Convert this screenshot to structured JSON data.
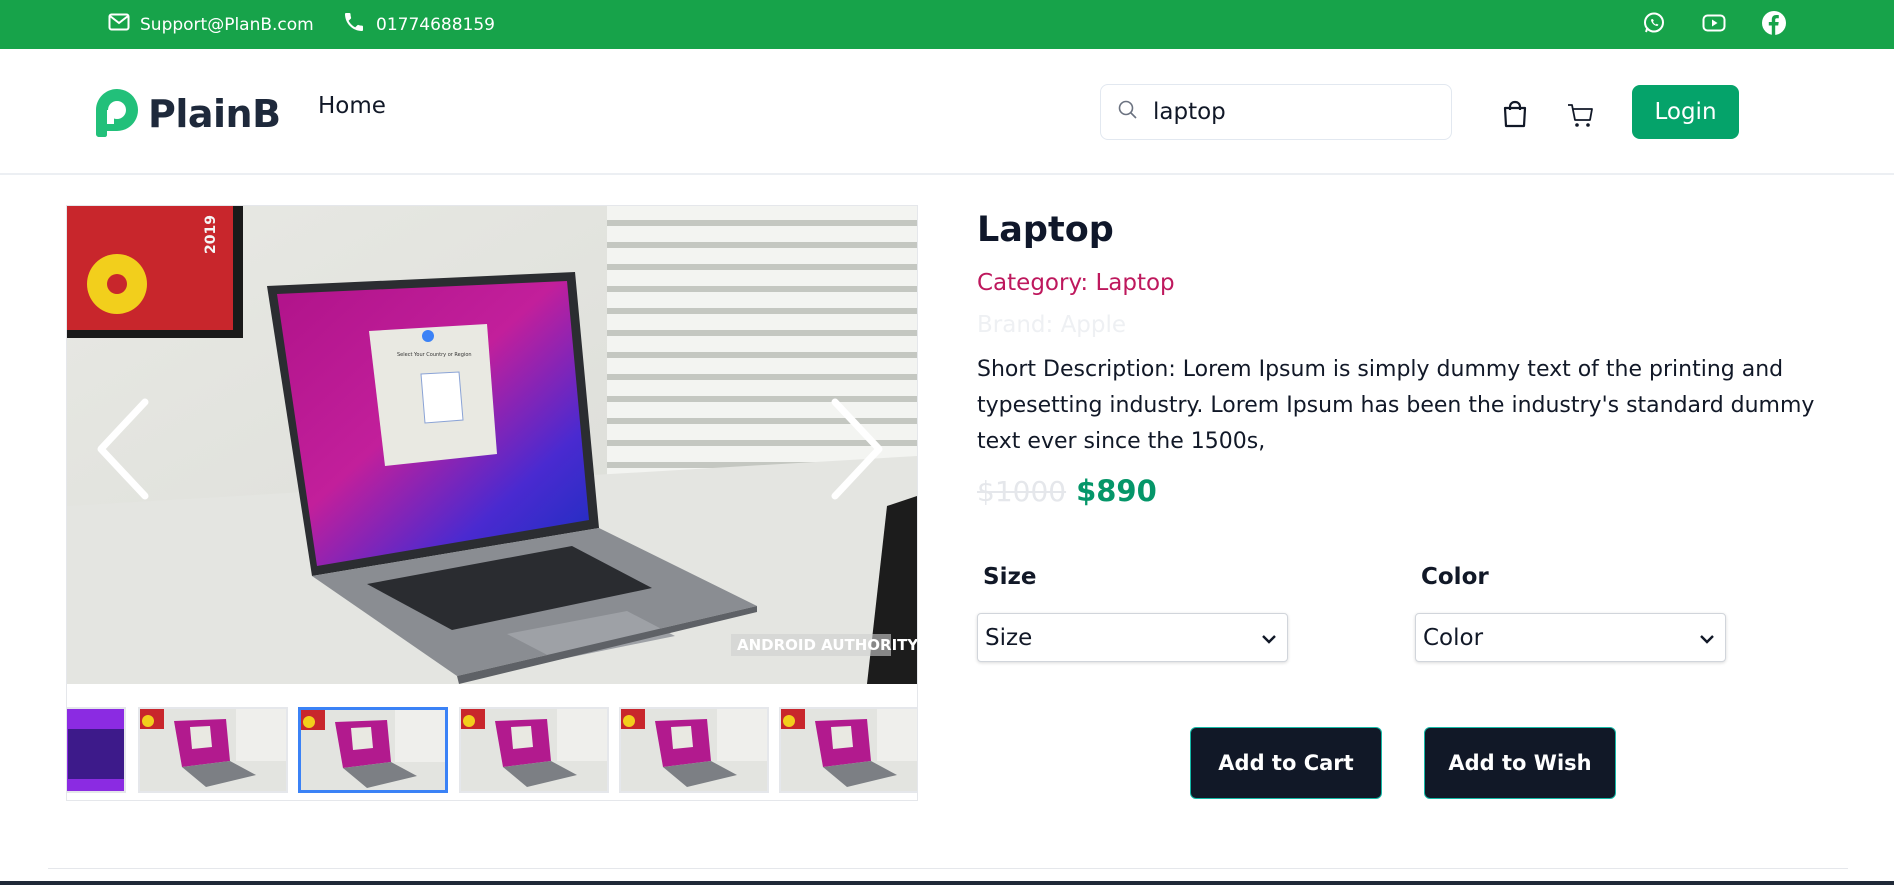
{
  "topbar": {
    "email": "Support@PlanB.com",
    "phone": "01774688159",
    "bg_color": "#17a34a",
    "icons": [
      "mail-icon",
      "phone-icon",
      "whatsapp-icon",
      "youtube-icon",
      "facebook-icon"
    ]
  },
  "header": {
    "logo_text": "PlainB",
    "nav_home": "Home",
    "search_value": "laptop",
    "login_label": "Login",
    "accent_color": "#05a36a",
    "icons": [
      "search-icon",
      "shopping-bag-icon",
      "cart-icon"
    ]
  },
  "gallery": {
    "watermark": "ANDROID AUTHORITY",
    "screen_title": "Select Your Country or Region",
    "poster_year": "2019",
    "thumbnail_count": 6,
    "active_thumbnail": 3
  },
  "product": {
    "title": "Laptop",
    "category": "Category: Laptop",
    "brand": "Brand: Apple",
    "description": "Short Description: Lorem Ipsum is simply dummy text of the printing and typesetting industry. Lorem Ipsum has been the industry's standard dummy text ever since the 1500s,",
    "old_price": "$1000",
    "new_price": "$890",
    "category_color": "#be185d",
    "price_color": "#059669"
  },
  "options": {
    "size_label": "Size",
    "size_value": "Size",
    "color_label": "Color",
    "color_value": "Color"
  },
  "actions": {
    "add_to_cart": "Add to Cart",
    "add_to_wish": "Add to Wish"
  }
}
